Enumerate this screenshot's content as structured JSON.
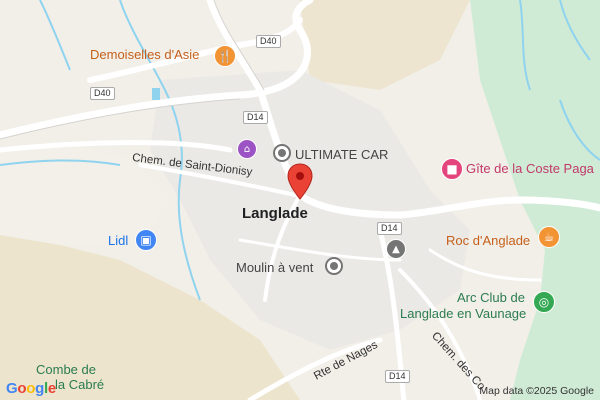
{
  "map": {
    "town": "Langlade",
    "pois": [
      {
        "name": "Demoiselles d'Asie",
        "icon": "fork-knife-icon",
        "color": "#f29433"
      },
      {
        "name": "ULTIMATE CAR",
        "icon": "circle-dot-icon",
        "color": "#757575"
      },
      {
        "name": "Gîte de la Coste Paga",
        "icon": "bed-icon",
        "color": "#e3447c"
      },
      {
        "name": "Roc d'Anglade",
        "icon": "cocktail-icon",
        "color": "#f29433"
      },
      {
        "name": "Lidl",
        "icon": "shopping-cart-icon",
        "color": "#4285f4"
      },
      {
        "name": "Moulin à vent",
        "icon": "circle-dot-icon",
        "color": "#757575"
      },
      {
        "name": "Arc Club de Langlade en Vaunage",
        "line1": "Arc Club de",
        "line2": "Langlade en Vaunage",
        "icon": "target-icon",
        "color": "#34a853"
      },
      {
        "name": "Combe de la Cabré",
        "line1": "Combe de",
        "line2": "la Cabré"
      }
    ],
    "roads": {
      "chem_saint_dionisy": "Chem. de Saint-Dionisy",
      "rte_de_nages": "Rte de Nages",
      "chem_des_co": "Chem. des Co"
    },
    "shields": [
      "D40",
      "D40",
      "D14",
      "D14",
      "D14"
    ],
    "attribution": "Map data ©2025 Google",
    "logo": "Google",
    "marker_color": "#ea4335"
  }
}
